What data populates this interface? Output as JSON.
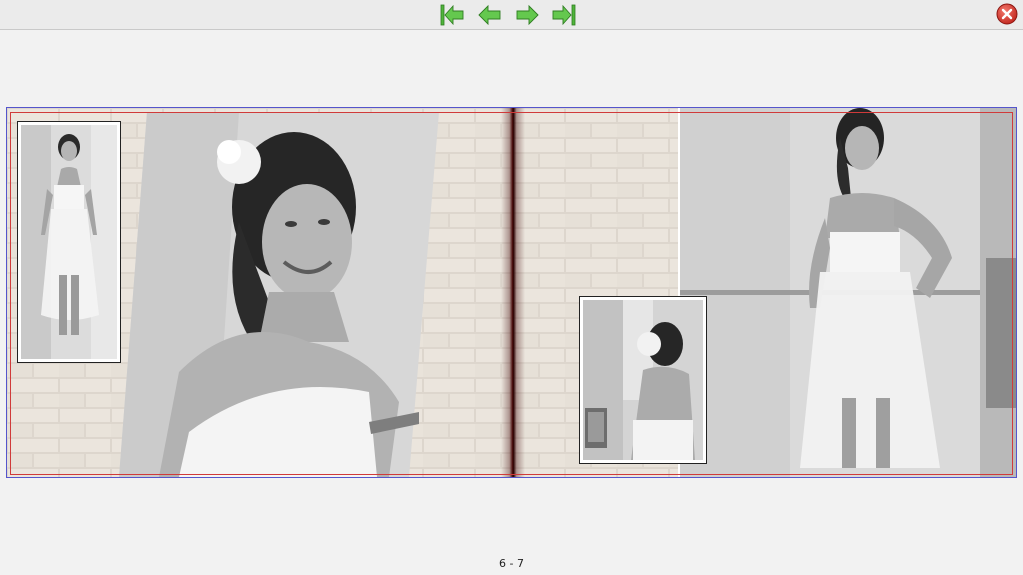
{
  "toolbar": {
    "buttons": [
      {
        "name": "first-page",
        "icon": "first-page-icon"
      },
      {
        "name": "previous-page",
        "icon": "arrow-left-icon"
      },
      {
        "name": "next-page",
        "icon": "arrow-right-icon"
      },
      {
        "name": "last-page",
        "icon": "last-page-icon"
      }
    ],
    "close_icon": "close-icon",
    "accent_green": "#5fc24a",
    "close_red": "#d9302a"
  },
  "album": {
    "page_indicator": "6 - 7",
    "photos": [
      {
        "name": "small-full-length-photo",
        "page": "left"
      },
      {
        "name": "large-portrait-photo",
        "page": "left"
      },
      {
        "name": "back-view-photo",
        "page": "right"
      },
      {
        "name": "full-length-pose-photo",
        "page": "right"
      }
    ]
  }
}
